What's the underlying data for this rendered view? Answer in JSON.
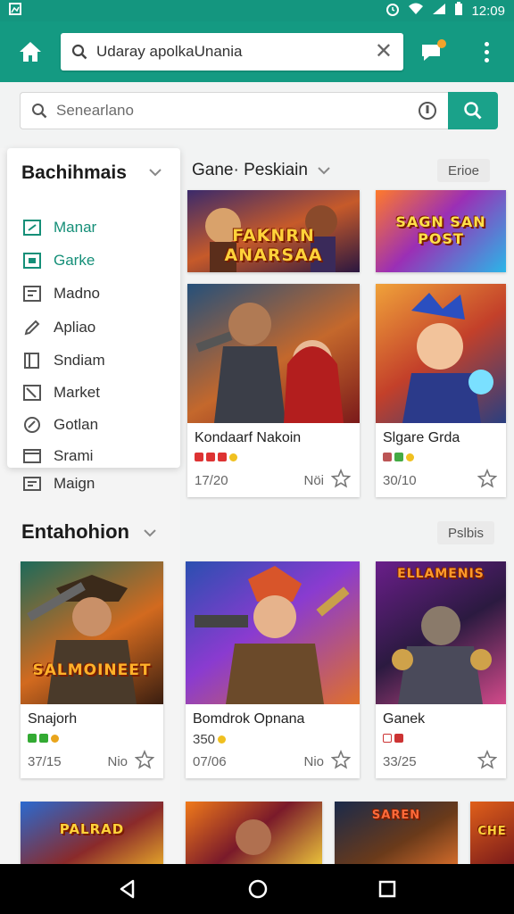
{
  "status_bar": {
    "time": "12:09"
  },
  "app_bar": {
    "url": "Udaray apolkaUnania",
    "accent": "#149a82"
  },
  "search": {
    "placeholder": "Senearlano"
  },
  "categories": {
    "title": "Bachihmais",
    "items": [
      {
        "label": "Manar",
        "icon": "game-icon"
      },
      {
        "label": "Garke",
        "icon": "square-icon"
      },
      {
        "label": "Madno",
        "icon": "media-icon"
      },
      {
        "label": "Apliao",
        "icon": "pencil-icon"
      },
      {
        "label": "Sndiam",
        "icon": "book-icon"
      },
      {
        "label": "Market",
        "icon": "tag-icon"
      },
      {
        "label": "Gotlan",
        "icon": "badge-icon"
      },
      {
        "label": "Srami",
        "icon": "window-icon"
      }
    ],
    "extra_item": "Maign"
  },
  "section2": {
    "title": "Entahohion",
    "pill": "Pslbis"
  },
  "main": {
    "header": "Gane· Peskiain",
    "pill": "Erioe"
  },
  "banners": [
    {
      "art_text": "FAKNRN ANARSAA"
    },
    {
      "art_text": "SAGN SAN POST"
    }
  ],
  "cards": [
    {
      "name": "Kondaarf Nakoin",
      "meta": "17/20",
      "rating": "Nöi",
      "art_text": ""
    },
    {
      "name": "Slgare Grda",
      "meta": "30/10",
      "rating": "",
      "art_text": ""
    },
    {
      "name": "Snajorh",
      "meta": "37/15",
      "rating": "Nio",
      "art_text": "SALMOINEET"
    },
    {
      "name": "Bomdrok Opnana",
      "meta": "07/06",
      "rating": "Nio",
      "art_text": "",
      "price": "350"
    },
    {
      "name": "Ganek",
      "meta": "33/25",
      "rating": "",
      "art_text": "ELLAMENIS"
    }
  ],
  "bottom_row": [
    {
      "art_text": "PALRAD"
    },
    {
      "art_text": ""
    },
    {
      "art_text": "SAREN"
    },
    {
      "art_text": "CHE"
    }
  ]
}
